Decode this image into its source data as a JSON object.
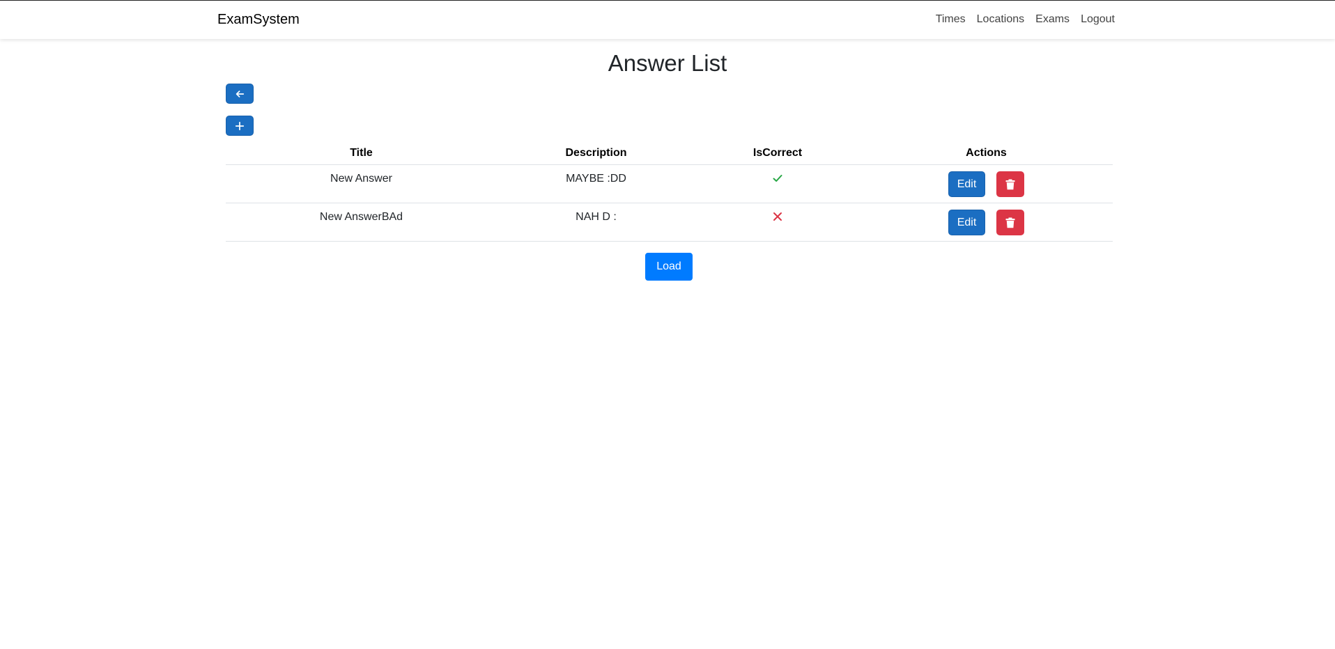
{
  "navbar": {
    "brand": "ExamSystem",
    "links": [
      "Times",
      "Locations",
      "Exams",
      "Logout"
    ]
  },
  "page": {
    "title": "Answer List",
    "back_icon": "arrow-left-icon",
    "add_icon": "plus-icon",
    "load_label": "Load"
  },
  "table": {
    "headers": [
      "Title",
      "Description",
      "IsCorrect",
      "Actions"
    ],
    "rows": [
      {
        "title": "New Answer",
        "description": "MAYBE :DD",
        "is_correct": true,
        "edit_label": "Edit"
      },
      {
        "title": "New AnswerBAd",
        "description": "NAH D :",
        "is_correct": false,
        "edit_label": "Edit"
      }
    ]
  },
  "colors": {
    "primary": "#1b6ec2",
    "load_button": "#007bff",
    "danger": "#dc3545",
    "check": "#28a745",
    "cross": "#dc3545"
  }
}
